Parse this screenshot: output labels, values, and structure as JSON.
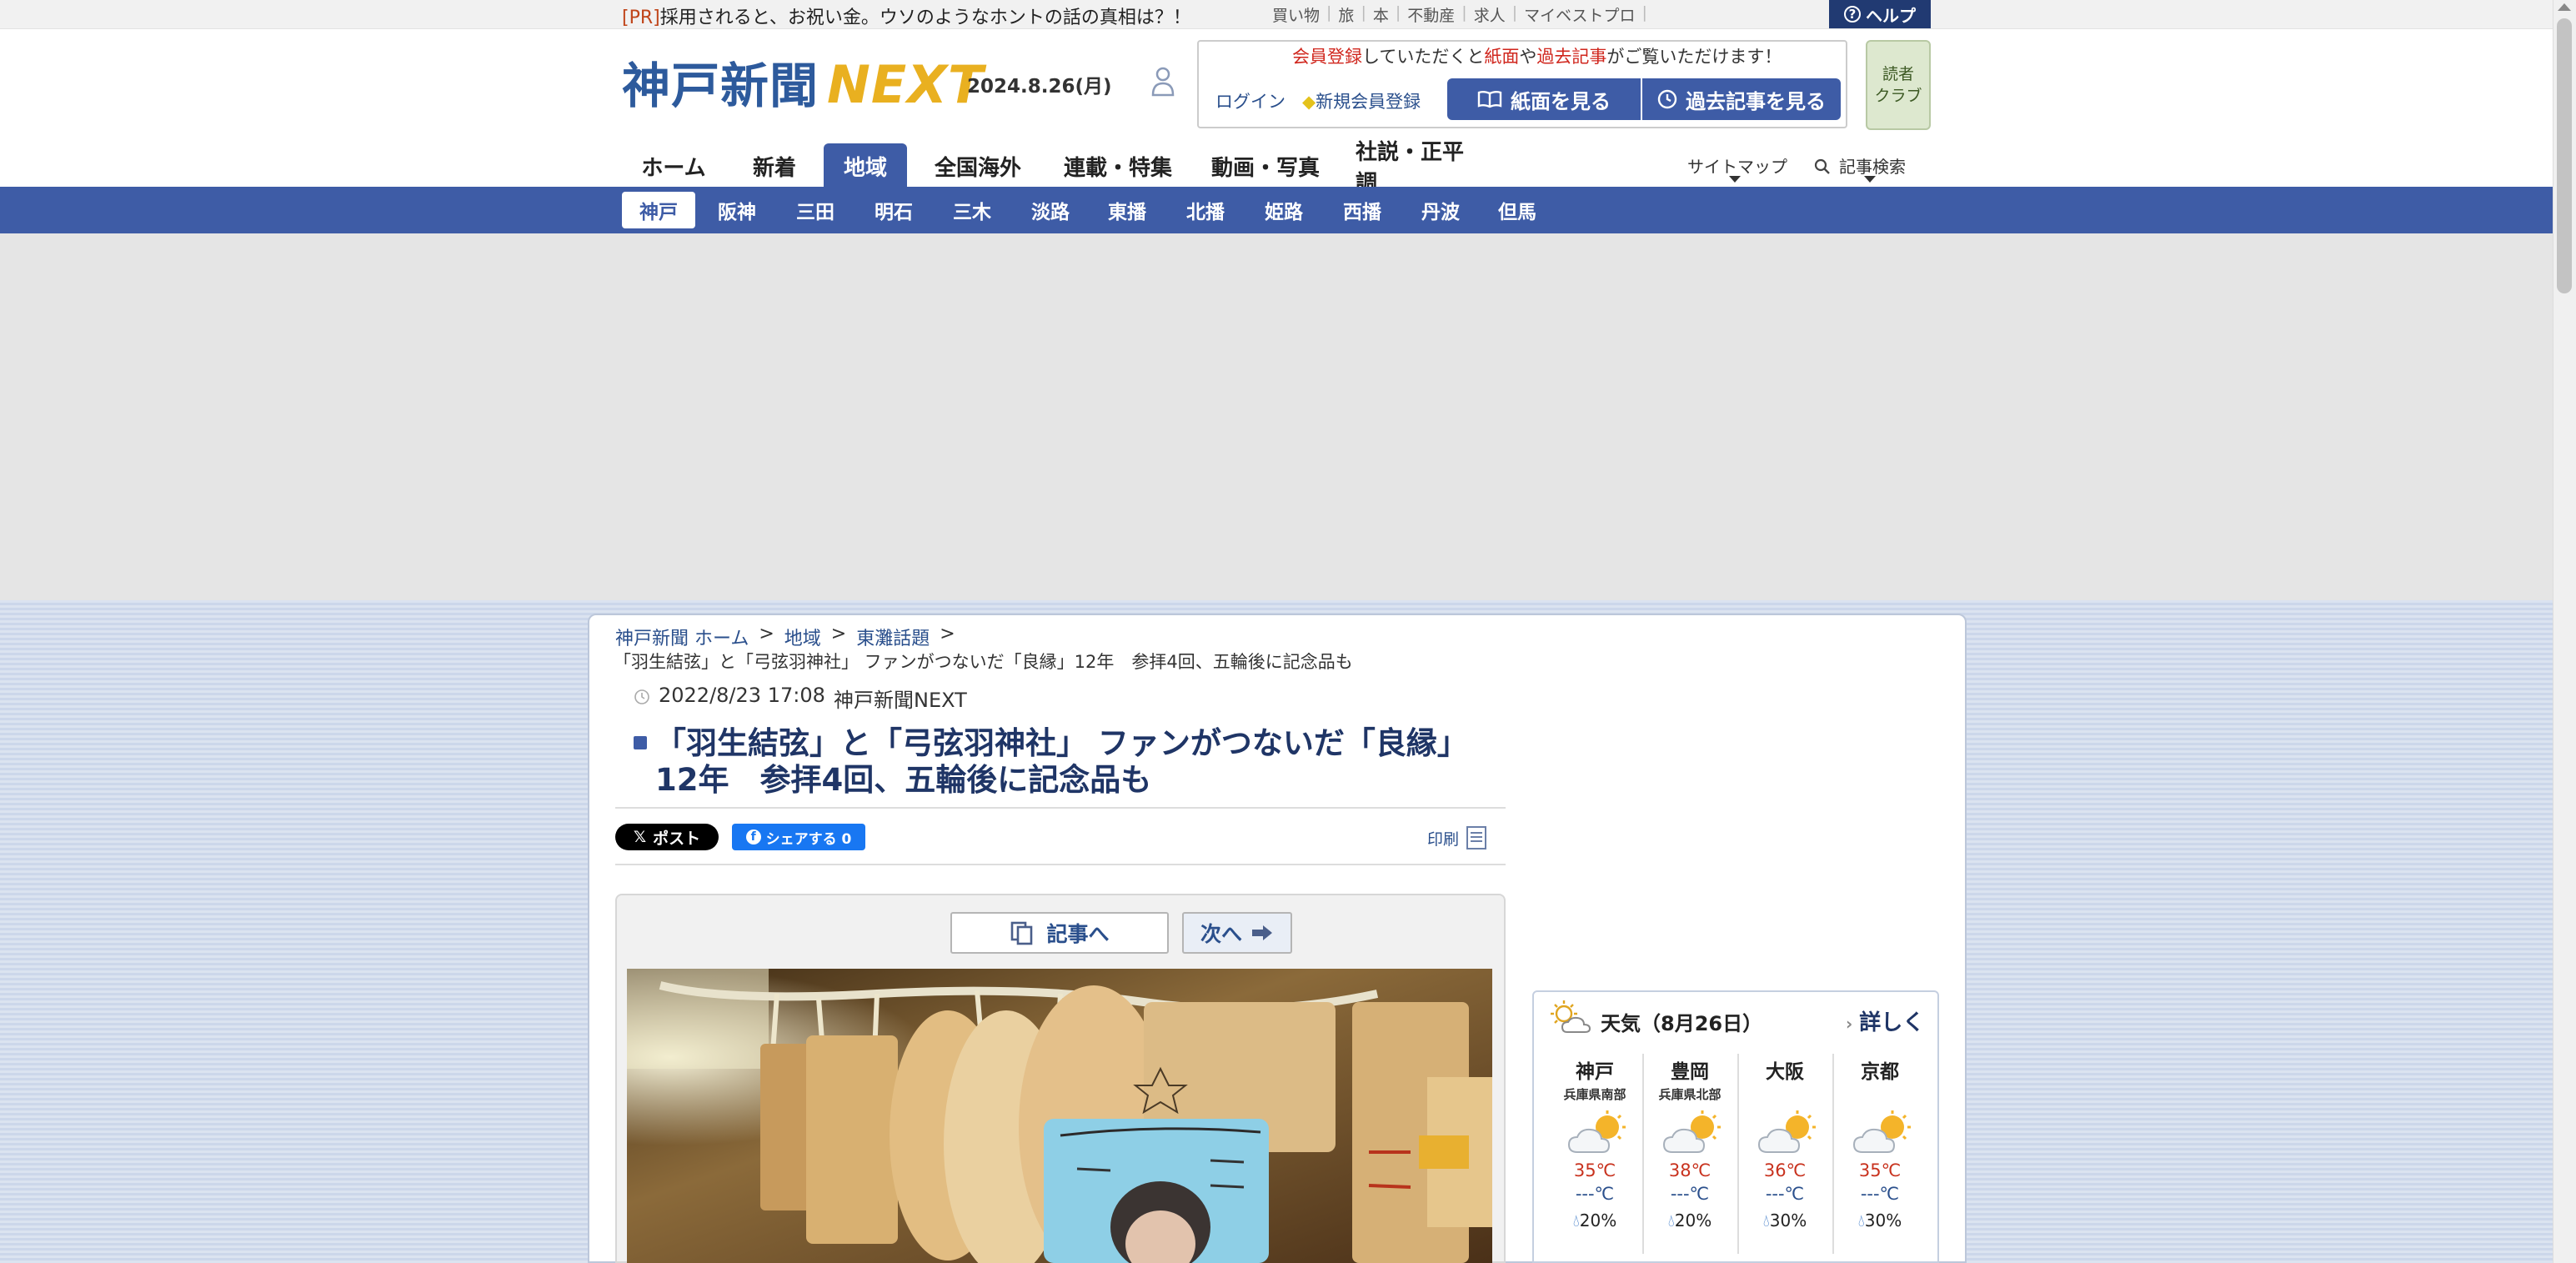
{
  "topbar": {
    "pr_tag": "[PR]",
    "pr_text": "採用されると、お祝い金。ウソのようなホントの話の真相は？！",
    "links": [
      "買い物",
      "旅",
      "本",
      "不動産",
      "求人",
      "マイベストプロ"
    ],
    "help_label": "ヘルプ"
  },
  "header": {
    "logo_main": "神戸新聞",
    "logo_next": "NEXT",
    "date": "2024.8.26(月)",
    "member_msg_1": "会員登録",
    "member_msg_2": "していただくと",
    "member_msg_3": "紙面",
    "member_msg_4": "や",
    "member_msg_5": "過去記事",
    "member_msg_6": "がご覧いただけます！",
    "login_label": "ログイン",
    "register_label": "新規会員登録",
    "view_paper_label": "紙面を見る",
    "view_past_label": "過去記事を見る",
    "reader_club_line1": "読者",
    "reader_club_line2": "クラブ"
  },
  "nav": {
    "items": [
      "ホーム",
      "新着",
      "地域",
      "全国海外",
      "連載・特集",
      "動画・写真",
      "社説・正平調"
    ],
    "active_index": 2,
    "sitemap_label": "サイトマップ",
    "search_label": "記事検索"
  },
  "subnav": {
    "items": [
      "神戸",
      "阪神",
      "三田",
      "明石",
      "三木",
      "淡路",
      "東播",
      "北播",
      "姫路",
      "西播",
      "丹波",
      "但馬"
    ],
    "active_index": 0
  },
  "breadcrumb": {
    "items": [
      "神戸新聞 ホーム",
      "地域",
      "東灘話題"
    ],
    "separator": ">",
    "current": "「羽生結弦」と「弓弦羽神社」 ファンがつないだ「良縁」12年　参拝4回、五輪後に記念品も"
  },
  "article": {
    "date": "2022/8/23 17:08",
    "source": "神戸新聞NEXT",
    "title": "「羽生結弦」と「弓弦羽神社」 ファンがつないだ「良縁」12年　参拝4回、五輪後に記念品も",
    "x_post_label": "ポスト",
    "fb_share_label": "シェアする 0",
    "print_label": "印刷",
    "btn_article_label": "記事へ",
    "btn_next_label": "次へ"
  },
  "weather": {
    "title": "天気（8月26日）",
    "more_label": "詳しく",
    "cities": [
      {
        "name": "神戸",
        "region": "兵庫県南部",
        "high": "35℃",
        "low": "---℃",
        "rain": "20%"
      },
      {
        "name": "豊岡",
        "region": "兵庫県北部",
        "high": "38℃",
        "low": "---℃",
        "rain": "20%"
      },
      {
        "name": "大阪",
        "region": "",
        "high": "36℃",
        "low": "---℃",
        "rain": "30%"
      },
      {
        "name": "京都",
        "region": "",
        "high": "35℃",
        "low": "---℃",
        "rain": "30%"
      }
    ]
  },
  "colors": {
    "nav_blue": "#3e5ca6",
    "title_navy": "#1f3566",
    "help_navy": "#213a72",
    "accent_red": "#d0261d"
  },
  "icons": [
    "help-icon",
    "user-icon",
    "book-icon",
    "clock-icon",
    "search-icon",
    "x-logo-icon",
    "facebook-icon",
    "print-icon",
    "copy-icon",
    "arrow-right-icon",
    "sun-cloud-icon",
    "raindrop-icon"
  ]
}
